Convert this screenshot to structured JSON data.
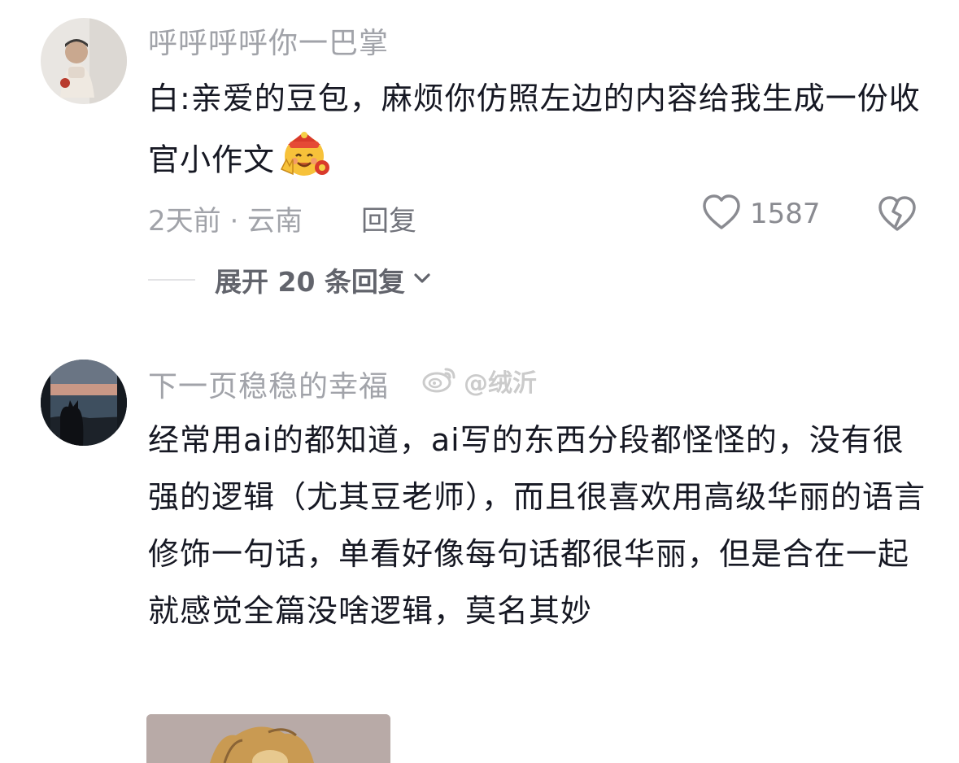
{
  "comments": [
    {
      "username": "呼呼呼呼你一巴掌",
      "text": "白:亲爱的豆包，麻烦你仿照左边的内容给我生成一份收官小作文",
      "emoji": "celebration-face-emoji",
      "time_location": "2天前 · 云南",
      "reply_label": "回复",
      "likes": "1587",
      "expand_label": "展开 20 条回复"
    },
    {
      "username": "下一页稳稳的幸福",
      "text": "经常用ai的都知道，ai写的东西分段都怪怪的，没有很强的逻辑（尤其豆老师），而且很喜欢用高级华丽的语言修饰一句话，单看好像每句话都很华丽，但是合在一起就感觉全篇没啥逻辑，莫名其妙"
    }
  ],
  "watermark": {
    "text": "@绒沂",
    "icon": "weibo-icon"
  },
  "colors": {
    "text_primary": "#161823",
    "text_secondary": "#a1a3a9",
    "reply": "#70727a",
    "expand": "#62646c"
  }
}
